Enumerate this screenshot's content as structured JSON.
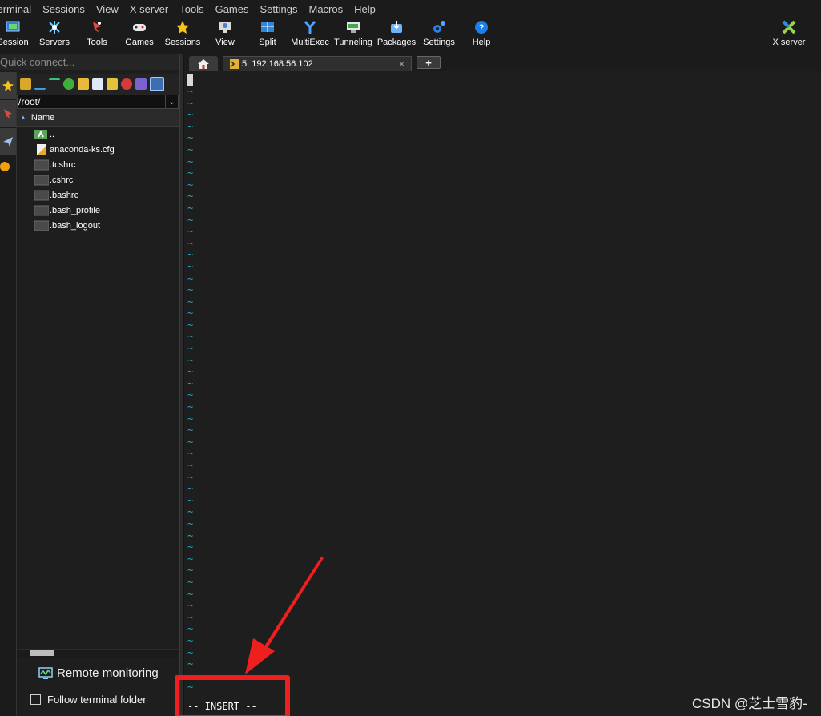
{
  "menubar": {
    "items": [
      "Terminal",
      "Sessions",
      "View",
      "X server",
      "Tools",
      "Games",
      "Settings",
      "Macros",
      "Help"
    ]
  },
  "toolbar": {
    "session": "Session",
    "servers": "Servers",
    "tools": "Tools",
    "games": "Games",
    "sessions": "Sessions",
    "view": "View",
    "split": "Split",
    "multiexec": "MultiExec",
    "tunneling": "Tunneling",
    "packages": "Packages",
    "settings": "Settings",
    "help": "Help",
    "xserver": "X server"
  },
  "quick_connect": {
    "placeholder": "Quick connect..."
  },
  "sftp": {
    "path": "/root/",
    "column_name": "Name",
    "files": [
      "..",
      "anaconda-ks.cfg",
      ".tcshrc",
      ".cshrc",
      ".bashrc",
      ".bash_profile",
      ".bash_logout"
    ]
  },
  "bottom": {
    "remote_monitoring": "Remote monitoring",
    "follow_terminal_folder": "Follow terminal folder"
  },
  "tabs": {
    "session_label": "5. 192.168.56.102",
    "close": "×",
    "new": "+"
  },
  "terminal": {
    "tilde": "~",
    "insert_line": "-- INSERT --"
  },
  "watermark": "CSDN @芝士雪豹-",
  "colors": {
    "accent_red": "#f01f1f",
    "tilde_cyan": "#2aa7c9",
    "background": "#1e1e1e"
  }
}
